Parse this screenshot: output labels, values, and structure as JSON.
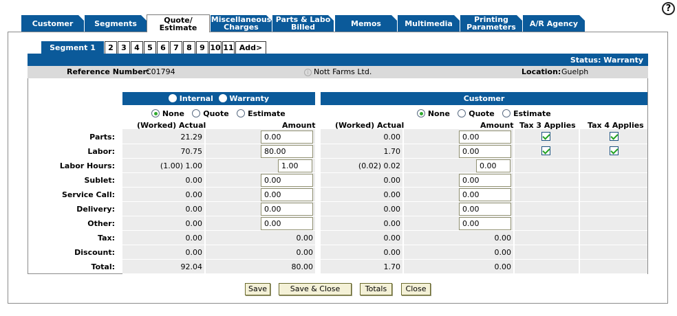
{
  "help_label": "?",
  "tabs": [
    {
      "line1": "Customer",
      "line2": ""
    },
    {
      "line1": "Segments",
      "line2": ""
    },
    {
      "line1": "Quote/",
      "line2": "Estimate"
    },
    {
      "line1": "Miscellaneous",
      "line2": "Charges"
    },
    {
      "line1": "Parts & Labo",
      "line2": "Billed"
    },
    {
      "line1": "Memos",
      "line2": ""
    },
    {
      "line1": "Multimedia",
      "line2": ""
    },
    {
      "line1": "Printing",
      "line2": "Parameters"
    },
    {
      "line1": "A/R Agency",
      "line2": ""
    }
  ],
  "segment_tabs": [
    "Segment 1",
    "2",
    "3",
    "4",
    "5",
    "6",
    "7",
    "8",
    "9",
    "10",
    "11",
    "Add>"
  ],
  "status": "Status: Warranty",
  "reference_label": "Reference Number:",
  "reference_value": "C01794",
  "customer_name": "Nott Farms Ltd.",
  "location_label": "Location:",
  "location_value": "Guelph",
  "left_header": {
    "internal": "Internal",
    "warranty": "Warranty"
  },
  "right_header": "Customer",
  "radio_options": {
    "none": "None",
    "quote": "Quote",
    "estimate": "Estimate"
  },
  "columns": {
    "worked_actual": "(Worked) Actual",
    "amount": "Amount",
    "tax3": "Tax 3 Applies",
    "tax4": "Tax 4 Applies"
  },
  "rows": [
    {
      "label": "Parts:",
      "w_actual": "21.29",
      "w_amount": "0.00",
      "c_actual": "0.00",
      "c_amount": "0.00"
    },
    {
      "label": "Labor:",
      "w_actual": "70.75",
      "w_amount": "80.00",
      "c_actual": "1.70",
      "c_amount": "0.00"
    },
    {
      "label": "Labor Hours:",
      "w_actual": "(1.00) 1.00",
      "w_amount": "1.00",
      "c_actual": "(0.02) 0.02",
      "c_amount": "0.00"
    },
    {
      "label": "Sublet:",
      "w_actual": "0.00",
      "w_amount": "0.00",
      "c_actual": "0.00",
      "c_amount": "0.00"
    },
    {
      "label": "Service Call:",
      "w_actual": "0.00",
      "w_amount": "0.00",
      "c_actual": "0.00",
      "c_amount": "0.00"
    },
    {
      "label": "Delivery:",
      "w_actual": "0.00",
      "w_amount": "0.00",
      "c_actual": "0.00",
      "c_amount": "0.00"
    },
    {
      "label": "Other:",
      "w_actual": "0.00",
      "w_amount": "0.00",
      "c_actual": "0.00",
      "c_amount": "0.00"
    },
    {
      "label": "Tax:",
      "w_actual": "0.00",
      "w_amount": "0.00",
      "c_actual": "0.00",
      "c_amount": "0.00"
    },
    {
      "label": "Discount:",
      "w_actual": "0.00",
      "w_amount": "0.00",
      "c_actual": "0.00",
      "c_amount": "0.00"
    },
    {
      "label": "Total:",
      "w_actual": "92.04",
      "w_amount": "80.00",
      "c_actual": "1.70",
      "c_amount": "0.00"
    }
  ],
  "buttons": {
    "save": "Save",
    "save_close": "Save & Close",
    "totals": "Totals",
    "close": "Close"
  },
  "colors": {
    "accent": "#0b5a9a",
    "row_bg": "#ececec",
    "button_bg": "#f4f1d7"
  }
}
